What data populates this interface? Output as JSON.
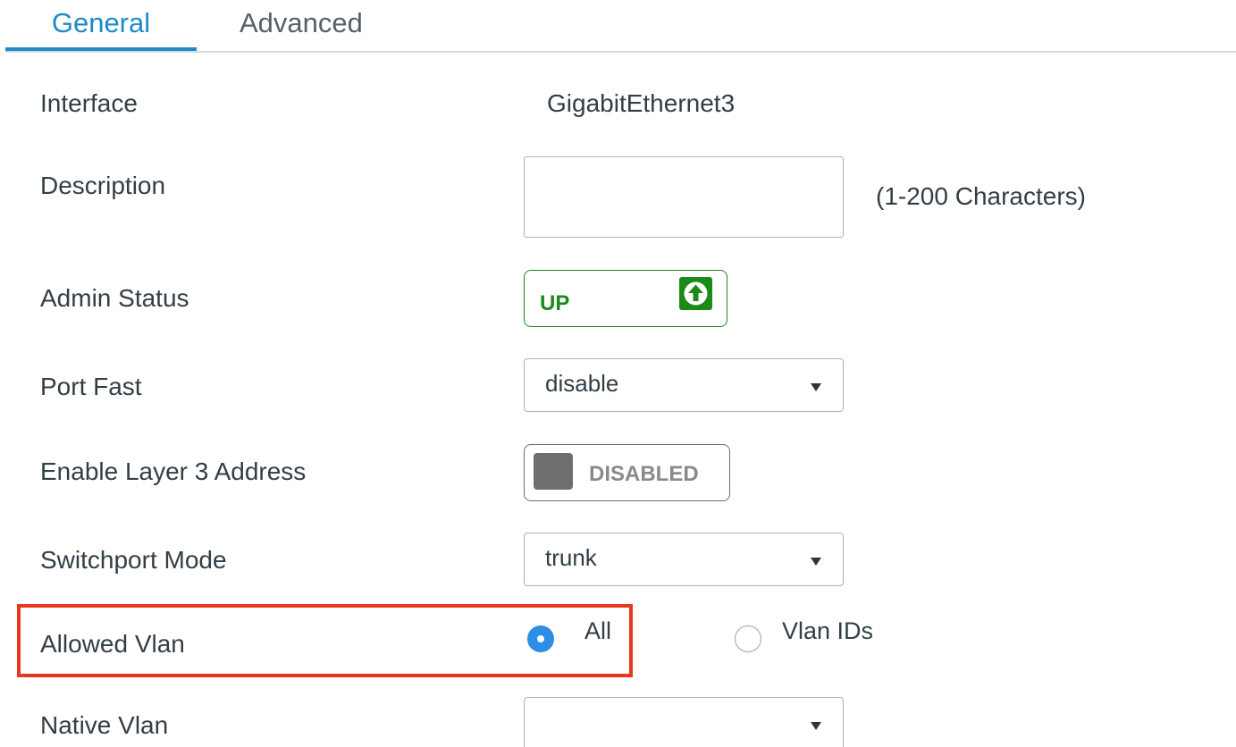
{
  "tabs": [
    {
      "label": "General",
      "active": true
    },
    {
      "label": "Advanced",
      "active": false
    }
  ],
  "colors": {
    "accent": "#1f8ac8",
    "status_up": "#1a8a18",
    "disabled": "#6e6e6e",
    "highlight": "#e8371f",
    "radio_selected": "#2e8ee5"
  },
  "form": {
    "interface": {
      "label": "Interface",
      "value": "GigabitEthernet3"
    },
    "description": {
      "label": "Description",
      "value": "",
      "hint": "(1-200 Characters)"
    },
    "admin_status": {
      "label": "Admin Status",
      "state": "UP",
      "icon": "arrow-up-icon"
    },
    "port_fast": {
      "label": "Port Fast",
      "value": "disable"
    },
    "layer3": {
      "label": "Enable Layer 3 Address",
      "state": "DISABLED"
    },
    "switchport_mode": {
      "label": "Switchport Mode",
      "value": "trunk"
    },
    "allowed_vlan": {
      "label": "Allowed Vlan",
      "options": [
        {
          "label": "All",
          "selected": true
        },
        {
          "label": "Vlan IDs",
          "selected": false
        }
      ]
    },
    "native_vlan": {
      "label": "Native Vlan",
      "value": ""
    }
  }
}
